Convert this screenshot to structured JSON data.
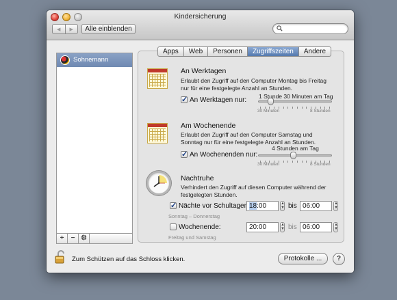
{
  "window": {
    "title": "Kindersicherung"
  },
  "toolbar": {
    "back_icon": "◀",
    "forward_icon": "▶",
    "show_all_label": "Alle einblenden",
    "search_placeholder": ""
  },
  "sidebar": {
    "users": [
      {
        "name": "Sohnemann",
        "selected": true
      }
    ],
    "add_label": "+",
    "remove_label": "−",
    "action_icon": "⚙"
  },
  "tabs": [
    {
      "label": "Apps",
      "active": false
    },
    {
      "label": "Web",
      "active": false
    },
    {
      "label": "Personen",
      "active": false
    },
    {
      "label": "Zugriffszeiten",
      "active": true
    },
    {
      "label": "Andere",
      "active": false
    }
  ],
  "weekdays": {
    "title": "An Werktagen",
    "description": "Erlaubt den Zugriff auf den Computer Montag bis Freitag nur für eine festgelegte Anzahl an Stunden.",
    "value_label": "1 Stunde 30 Minuten am Tag",
    "checkbox_label": "An Werktagen nur:",
    "checked": true,
    "slider_min": "30 Minuten",
    "slider_max": "8 Stunden",
    "slider_fraction": 0.14
  },
  "weekend": {
    "title": "Am Wochenende",
    "description": "Erlaubt den Zugriff auf den Computer Samstag und Sonntag nur für eine festgelegte Anzahl an Stunden.",
    "value_label": "4 Stunden am Tag",
    "checkbox_label": "An Wochenenden nur:",
    "checked": true,
    "slider_min": "30 Minuten",
    "slider_max": "8 Stunden",
    "slider_fraction": 0.47
  },
  "bedtime": {
    "title": "Nachtruhe",
    "description": "Verhindert den Zugriff auf diesen Computer während der festgelegten Stunden.",
    "school_nights": {
      "label": "Nächte vor Schultagen:",
      "checked": true,
      "from_hour": "18",
      "from_rest": ":00",
      "bis": "bis",
      "to": "06:00",
      "note": "Sonntag – Donnerstag"
    },
    "weekend": {
      "label": "Wochenende:",
      "checked": false,
      "from": "20:00",
      "bis": "bis",
      "to": "06:00",
      "note": "Freitag und Samstag"
    }
  },
  "footer": {
    "lock_text": "Zum Schützen auf das Schloss klicken.",
    "protokolle_label": "Protokolle ...",
    "help_label": "?"
  }
}
